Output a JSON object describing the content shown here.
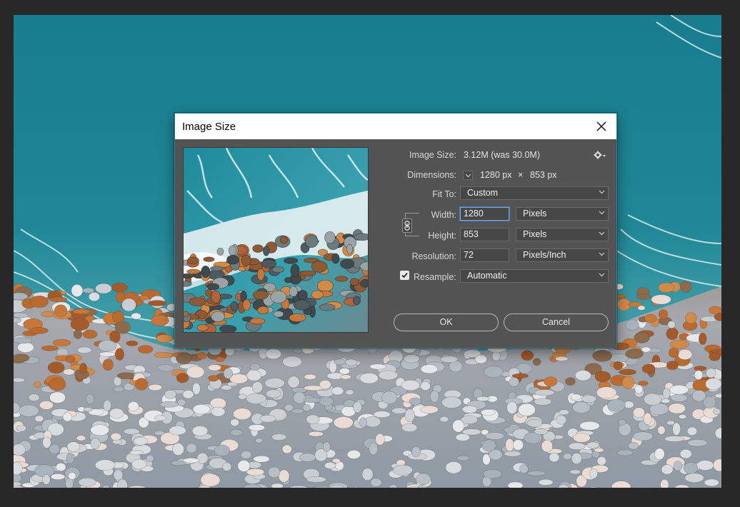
{
  "dialog": {
    "title": "Image Size",
    "image_size_label": "Image Size:",
    "image_size_value": "3.12M (was 30.0M)",
    "dimensions_label": "Dimensions:",
    "dimensions_width": "1280 px",
    "dimensions_x": "×",
    "dimensions_height": "853 px",
    "fit_to_label": "Fit To:",
    "fit_to_value": "Custom",
    "width_label": "Width:",
    "width_value": "1280",
    "width_unit": "Pixels",
    "height_label": "Height:",
    "height_value": "853",
    "height_unit": "Pixels",
    "resolution_label": "Resolution:",
    "resolution_value": "72",
    "resolution_unit": "Pixels/Inch",
    "resample_label": "Resample:",
    "resample_checked": true,
    "resample_value": "Automatic",
    "ok_label": "OK",
    "cancel_label": "Cancel"
  },
  "colors": {
    "dialog_bg": "#535353",
    "field_bg": "#474747",
    "focus_border": "#7aa5d9",
    "sea": "#1d7f8e",
    "workspace": "#282828"
  },
  "icons": {
    "close": "close-icon",
    "settings": "gear-icon",
    "constrain": "chain-link-icon",
    "dropdown": "chevron-down-icon",
    "check": "checkmark-icon"
  }
}
